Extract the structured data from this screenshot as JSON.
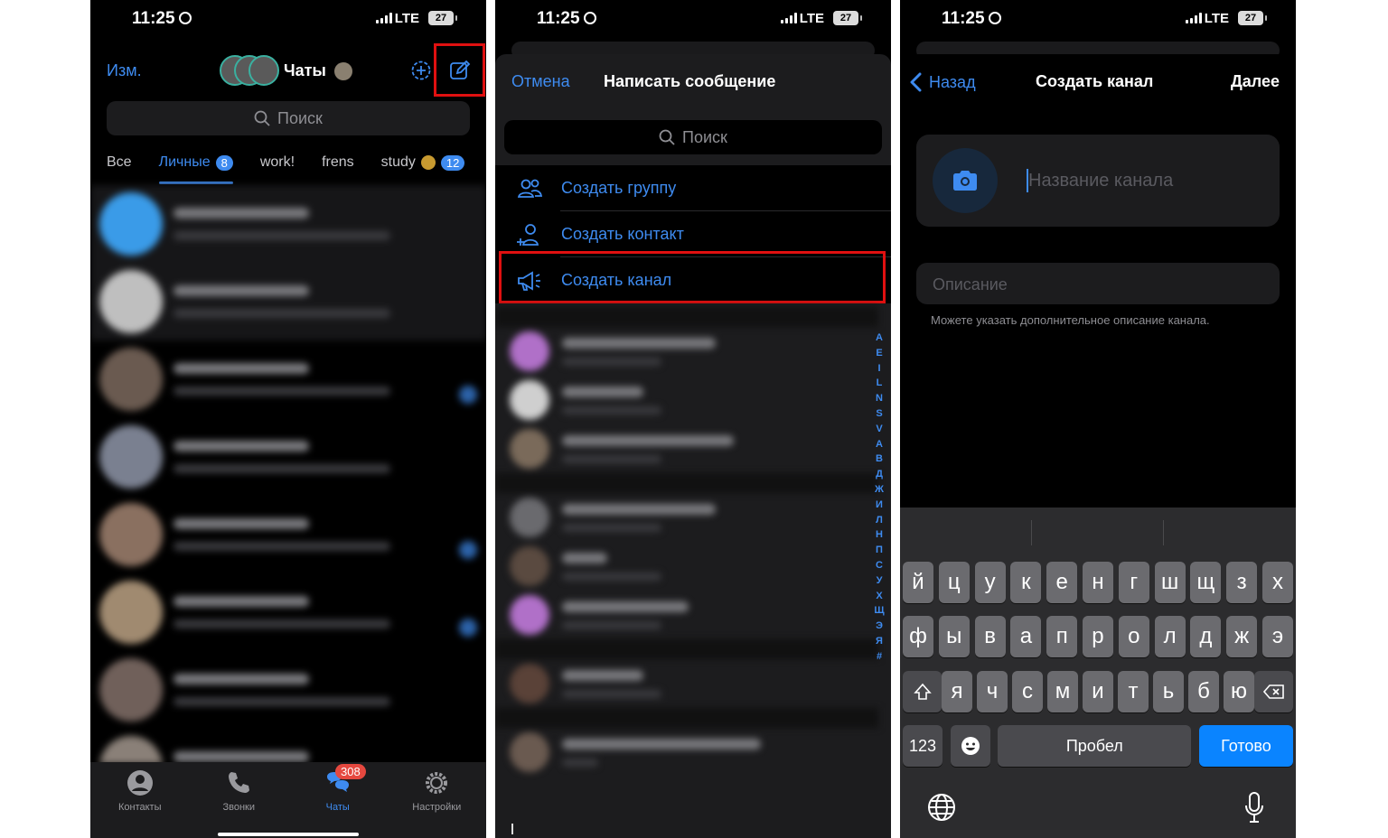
{
  "status": {
    "time": "11:25",
    "network": "LTE",
    "battery": "27"
  },
  "panel1": {
    "edit": "Изм.",
    "title": "Чаты",
    "search_placeholder": "Поиск",
    "tabs": [
      {
        "label": "Все"
      },
      {
        "label": "Личные",
        "badge": "8"
      },
      {
        "label": "work!"
      },
      {
        "label": "frens"
      },
      {
        "label": "study",
        "badge": "12"
      }
    ],
    "tabbar": [
      {
        "label": "Контакты"
      },
      {
        "label": "Звонки"
      },
      {
        "label": "Чаты",
        "badge": "308"
      },
      {
        "label": "Настройки"
      }
    ],
    "highlight_color": "#e01010"
  },
  "panel2": {
    "cancel": "Отмена",
    "title": "Написать сообщение",
    "search_placeholder": "Поиск",
    "menu": [
      {
        "label": "Создать группу",
        "icon": "group-icon"
      },
      {
        "label": "Создать контакт",
        "icon": "add-contact-icon"
      },
      {
        "label": "Создать канал",
        "icon": "megaphone-icon"
      }
    ],
    "index_letters": [
      "A",
      "E",
      "I",
      "L",
      "N",
      "S",
      "V",
      "А",
      "В",
      "Д",
      "Ж",
      "И",
      "Л",
      "Н",
      "П",
      "С",
      "У",
      "Х",
      "Щ",
      "Э",
      "Я",
      "#"
    ]
  },
  "panel3": {
    "back": "Назад",
    "title": "Создать канал",
    "next": "Далее",
    "name_placeholder": "Название канала",
    "description_placeholder": "Описание",
    "description_hint": "Можете указать дополнительное описание канала.",
    "keyboard": {
      "row1": [
        "й",
        "ц",
        "у",
        "к",
        "е",
        "н",
        "г",
        "ш",
        "щ",
        "з",
        "х"
      ],
      "row2": [
        "ф",
        "ы",
        "в",
        "а",
        "п",
        "р",
        "о",
        "л",
        "д",
        "ж",
        "э"
      ],
      "row3": [
        "я",
        "ч",
        "с",
        "м",
        "и",
        "т",
        "ь",
        "б",
        "ю"
      ],
      "numbers": "123",
      "space": "Пробел",
      "done": "Готово"
    }
  },
  "accent_color": "#3e8bf0"
}
